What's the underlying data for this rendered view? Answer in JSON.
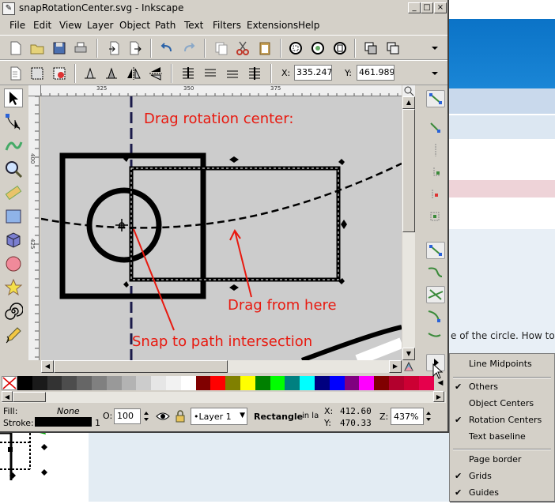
{
  "window": {
    "title": "snapRotationCenter.svg - Inkscape",
    "buttons": [
      "_",
      "□",
      "×"
    ]
  },
  "menubar": [
    "File",
    "Edit",
    "View",
    "Layer",
    "Object",
    "Path",
    "Text",
    "Filters",
    "Extensions",
    "Help"
  ],
  "coords": {
    "x_label": "X:",
    "x_value": "335.247",
    "y_label": "Y:",
    "y_value": "461.989"
  },
  "ruler": {
    "h_labels": [
      "325",
      "350",
      "375"
    ],
    "v_labels": [
      "400",
      "425"
    ]
  },
  "canvas": {
    "annotation_top": "Drag rotation center:",
    "annotation_drag": "Drag from here",
    "annotation_snap": "Snap to path intersection"
  },
  "palette": {
    "colors": [
      "#000000",
      "#1a1a1a",
      "#333333",
      "#4d4d4d",
      "#666666",
      "#808080",
      "#999999",
      "#b3b3b3",
      "#cccccc",
      "#e6e6e6",
      "#f2f2f2",
      "#ffffff",
      "#800000",
      "#ff0000",
      "#808000",
      "#ffff00",
      "#008000",
      "#00ff00",
      "#008080",
      "#00ffff",
      "#000080",
      "#0000ff",
      "#800080",
      "#ff00ff",
      "#800000",
      "#b3002d",
      "#cc0033",
      "#e6004c"
    ]
  },
  "status": {
    "fill_label": "Fill:",
    "fill_value": "None",
    "stroke_label": "Stroke:",
    "stroke_width": "1",
    "opacity_label": "O:",
    "opacity_value": "100",
    "layer": "•Layer 1",
    "message_bold": "Rectangle",
    "message_rest": "in la",
    "cursor_x_label": "X:",
    "cursor_x": "412.60",
    "cursor_y_label": "Y:",
    "cursor_y": "470.33",
    "zoom_label": "Z:",
    "zoom_value": "437%"
  },
  "snap_menu": {
    "items": [
      {
        "label": "Line Midpoints",
        "checked": false
      },
      {
        "label": "Others",
        "checked": true
      },
      {
        "label": "Object Centers",
        "checked": false
      },
      {
        "label": "Rotation Centers",
        "checked": true
      },
      {
        "label": "Text baseline",
        "checked": false
      },
      {
        "label": "Page border",
        "checked": false
      },
      {
        "label": "Grids",
        "checked": true
      },
      {
        "label": "Guides",
        "checked": true
      }
    ],
    "check_mark": "✔"
  },
  "background_page": {
    "text": "e of the circle. How to"
  }
}
